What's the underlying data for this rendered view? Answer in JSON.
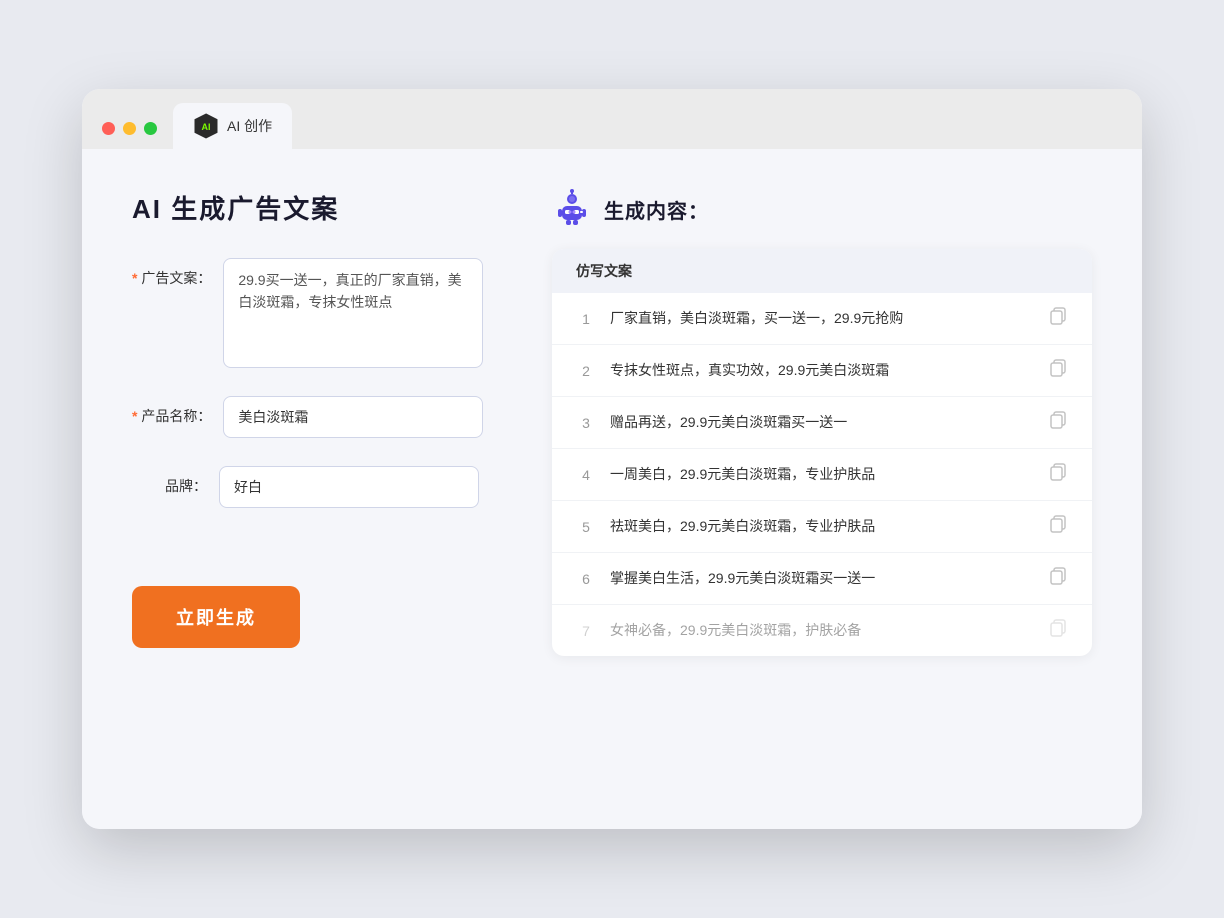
{
  "window": {
    "tab_title": "AI 创作"
  },
  "left_panel": {
    "page_title": "AI 生成广告文案",
    "fields": [
      {
        "label": "广告文案：",
        "required": true,
        "type": "textarea",
        "value": "29.9买一送一，真正的厂家直销，美白淡斑霜，专抹女性斑点",
        "name": "ad_copy"
      },
      {
        "label": "产品名称：",
        "required": true,
        "type": "input",
        "value": "美白淡斑霜",
        "name": "product_name"
      },
      {
        "label": "品牌：",
        "required": false,
        "type": "input",
        "value": "好白",
        "name": "brand"
      }
    ],
    "generate_button": "立即生成"
  },
  "right_panel": {
    "header_title": "生成内容：",
    "table_header": "仿写文案",
    "results": [
      {
        "num": 1,
        "text": "厂家直销，美白淡斑霜，买一送一，29.9元抢购",
        "dimmed": false
      },
      {
        "num": 2,
        "text": "专抹女性斑点，真实功效，29.9元美白淡斑霜",
        "dimmed": false
      },
      {
        "num": 3,
        "text": "赠品再送，29.9元美白淡斑霜买一送一",
        "dimmed": false
      },
      {
        "num": 4,
        "text": "一周美白，29.9元美白淡斑霜，专业护肤品",
        "dimmed": false
      },
      {
        "num": 5,
        "text": "祛斑美白，29.9元美白淡斑霜，专业护肤品",
        "dimmed": false
      },
      {
        "num": 6,
        "text": "掌握美白生活，29.9元美白淡斑霜买一送一",
        "dimmed": false
      },
      {
        "num": 7,
        "text": "女神必备，29.9元美白淡斑霜，护肤必备",
        "dimmed": true
      }
    ]
  }
}
